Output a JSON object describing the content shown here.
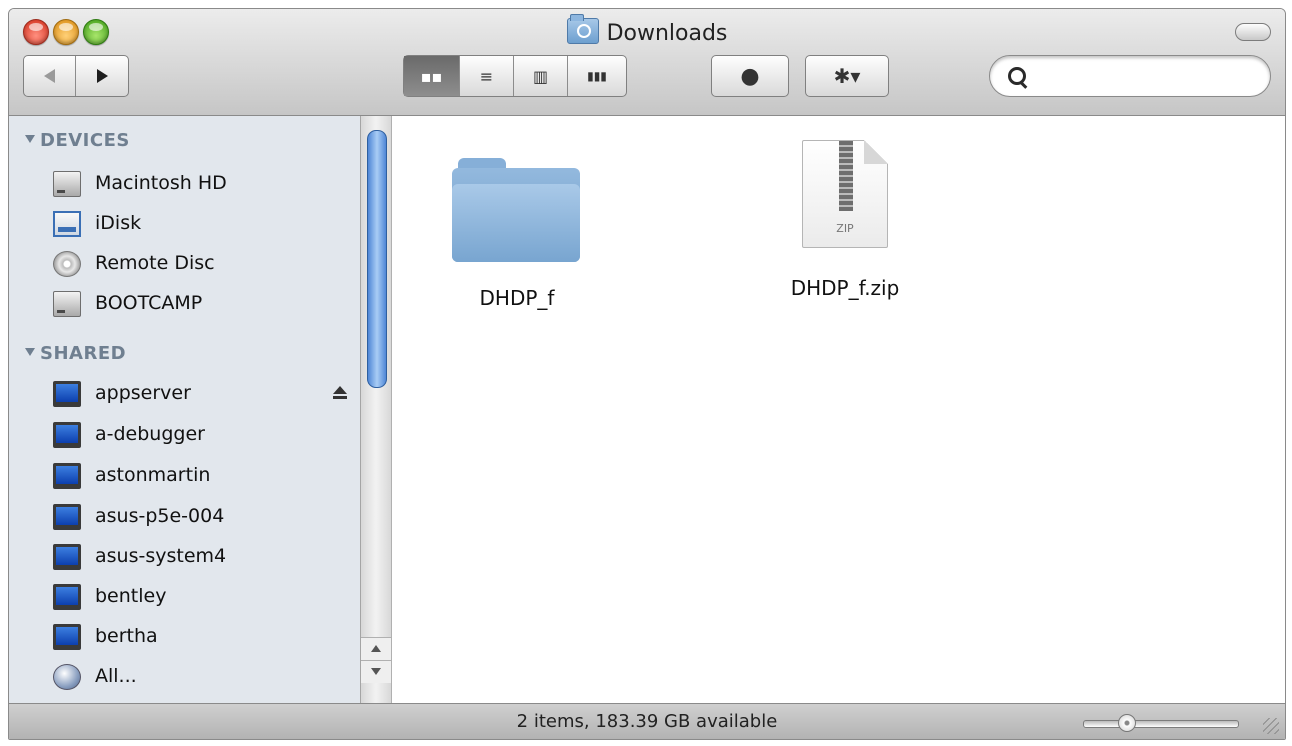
{
  "window": {
    "title": "Downloads",
    "title_icon": "downloads-folder-icon"
  },
  "toolbar": {
    "nav": {
      "back_icon": "back-arrow-icon",
      "forward_icon": "forward-arrow-icon"
    },
    "view_modes": [
      {
        "name": "icon-view",
        "glyph": "▪▪",
        "active": true
      },
      {
        "name": "list-view",
        "glyph": "≡",
        "active": false
      },
      {
        "name": "column-view",
        "glyph": "▥",
        "active": false
      },
      {
        "name": "coverflow-view",
        "glyph": "▮▮▮",
        "active": false
      }
    ],
    "quicklook_glyph": "●",
    "action_glyph": "✱▾",
    "search": {
      "value": "",
      "placeholder": ""
    }
  },
  "sidebar": {
    "sections": [
      {
        "title": "DEVICES",
        "items": [
          {
            "label": "Macintosh HD",
            "icon": "hard-drive-icon"
          },
          {
            "label": "iDisk",
            "icon": "idisk-icon"
          },
          {
            "label": "Remote Disc",
            "icon": "disc-icon"
          },
          {
            "label": "BOOTCAMP",
            "icon": "hard-drive-icon"
          }
        ]
      },
      {
        "title": "SHARED",
        "items": [
          {
            "label": "appserver",
            "icon": "network-computer-icon",
            "eject": true
          },
          {
            "label": "a-debugger",
            "icon": "network-computer-icon"
          },
          {
            "label": "astonmartin",
            "icon": "network-computer-icon"
          },
          {
            "label": "asus-p5e-004",
            "icon": "network-computer-icon"
          },
          {
            "label": "asus-system4",
            "icon": "network-computer-icon"
          },
          {
            "label": "bentley",
            "icon": "network-computer-icon"
          },
          {
            "label": "bertha",
            "icon": "network-computer-icon"
          },
          {
            "label": "All...",
            "icon": "network-globe-icon"
          }
        ]
      }
    ]
  },
  "content": {
    "files": [
      {
        "name": "DHDP_f",
        "kind": "folder"
      },
      {
        "name": "DHDP_f.zip",
        "kind": "zip",
        "badge": "ZIP"
      }
    ]
  },
  "status": {
    "text": "2 items, 183.39 GB available",
    "icon_size_level": 0.25
  }
}
